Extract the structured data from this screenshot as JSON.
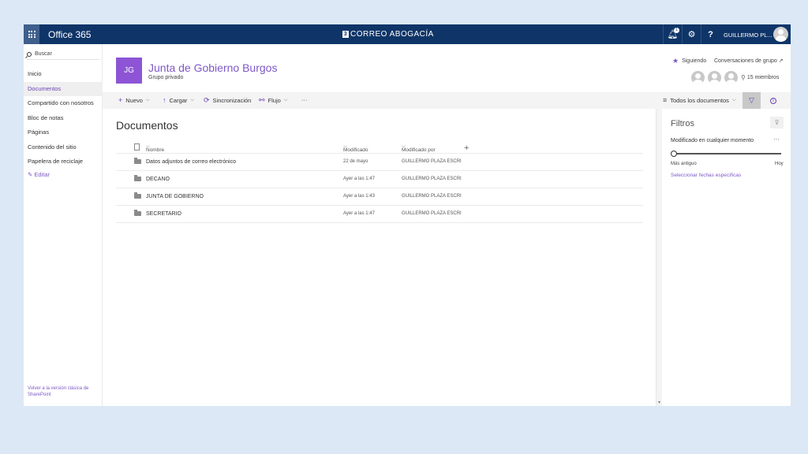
{
  "suitebar": {
    "brand": "Office 365",
    "logo_mark": "3",
    "logo_text": "CORREO ABOGACÍA",
    "notification_count": "1",
    "help_label": "?",
    "user_name": "GUILLERMO PL..."
  },
  "leftnav": {
    "search_label": "Buscar",
    "items": [
      {
        "label": "Inicio"
      },
      {
        "label": "Documentos"
      },
      {
        "label": "Compartido con nosotros"
      },
      {
        "label": "Bloc de notas"
      },
      {
        "label": "Páginas"
      },
      {
        "label": "Contenido del sitio"
      },
      {
        "label": "Papelera de reciclaje"
      }
    ],
    "edit_label": "Editar",
    "classic_link": "Volver a la versión clásica de SharePoint"
  },
  "site": {
    "initials": "JG",
    "title": "Junta de Gobierno Burgos",
    "subtitle": "Grupo privado",
    "following": "Siguiendo",
    "conversations": "Conversaciones de grupo",
    "members": "15 miembros"
  },
  "commandbar": {
    "new": "Nuevo",
    "upload": "Cargar",
    "sync": "Sincronización",
    "flow": "Flujo",
    "more": "···",
    "views": "Todos los documentos"
  },
  "library": {
    "title": "Documentos",
    "columns": {
      "name": "Nombre",
      "modified": "Modificado",
      "modified_by": "Modificado por"
    },
    "rows": [
      {
        "name": "Datos adjuntos de correo electrónico",
        "modified": "22 de mayo",
        "modified_by": "GUILLERMO PLAZA ESCRI"
      },
      {
        "name": "DECANO",
        "modified": "Ayer a las 1:47",
        "modified_by": "GUILLERMO PLAZA ESCRI"
      },
      {
        "name": "JUNTA DE GOBIERNO",
        "modified": "Ayer a las 1:43",
        "modified_by": "GUILLERMO PLAZA ESCRI"
      },
      {
        "name": "SECRETARIO",
        "modified": "Ayer a las 1:47",
        "modified_by": "GUILLERMO PLAZA ESCRI"
      }
    ]
  },
  "filters": {
    "title": "Filtros",
    "modified_label": "Modificado en cualquier momento",
    "more": "···",
    "older": "Más antiguo",
    "today": "Hoy",
    "specific_dates": "Seleccionar fechas específicas",
    "slider_position": 0
  },
  "colors": {
    "suitebar": "#0f3568",
    "accent": "#7e58c6",
    "site_logo": "#8d55d6",
    "page_background": "#dce8f5"
  }
}
